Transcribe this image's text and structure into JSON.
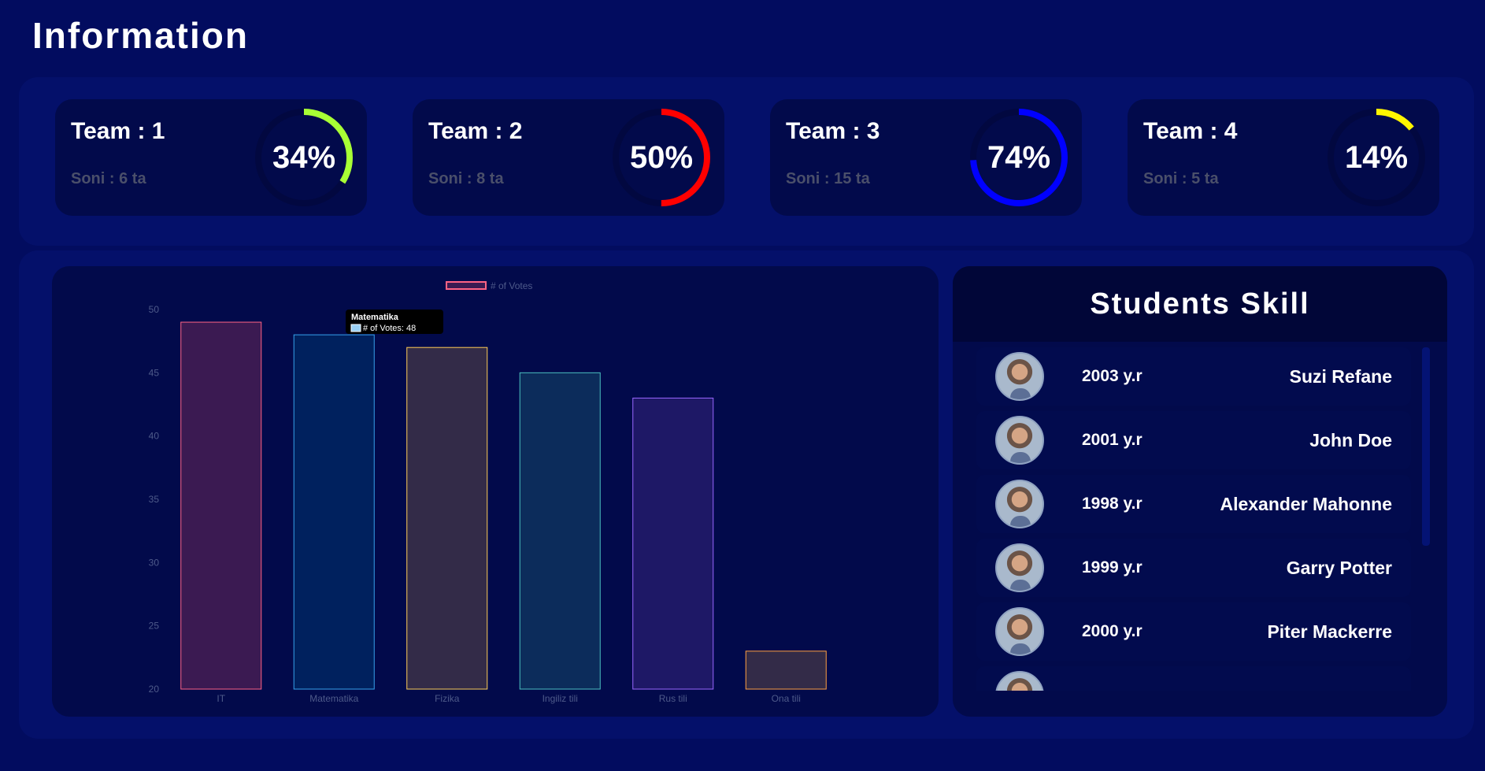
{
  "page": {
    "title": "Information"
  },
  "teams": [
    {
      "name": "Team : 1",
      "count": "Soni : 6 ta",
      "percent_label": "34%",
      "percent": 34,
      "color": "#a8ff35"
    },
    {
      "name": "Team : 2",
      "count": "Soni : 8 ta",
      "percent_label": "50%",
      "percent": 50,
      "color": "#ff0000"
    },
    {
      "name": "Team : 3",
      "count": "Soni : 15 ta",
      "percent_label": "74%",
      "percent": 74,
      "color": "#0000ff"
    },
    {
      "name": "Team : 4",
      "count": "Soni : 5 ta",
      "percent_label": "14%",
      "percent": 14,
      "color": "#fff500"
    }
  ],
  "skills": {
    "title": "Students Skill",
    "rows": [
      {
        "year": "2003 y.r",
        "name": "Suzi Refane",
        "avatar": "avatar-photo"
      },
      {
        "year": "2001 y.r",
        "name": "John Doe",
        "avatar": "avatar-photo"
      },
      {
        "year": "1998 y.r",
        "name": "Alexander Mahonne",
        "avatar": "avatar-photo"
      },
      {
        "year": "1999 y.r",
        "name": "Garry Potter",
        "avatar": "avatar-photo"
      },
      {
        "year": "2000 y.r",
        "name": "Piter Mackerre",
        "avatar": "avatar-photo"
      },
      {
        "year": "",
        "name": "",
        "avatar": "avatar-photo"
      }
    ]
  },
  "chart_data": {
    "type": "bar",
    "categories": [
      "IT",
      "Matematika",
      "Fizika",
      "Ingiliz tili",
      "Rus tili",
      "Ona tili"
    ],
    "series": [
      {
        "name": "# of Votes",
        "values": [
          49,
          48,
          47,
          45,
          43,
          23
        ]
      }
    ],
    "ylim": [
      20,
      50
    ],
    "yticks": [
      20,
      25,
      30,
      35,
      40,
      45,
      50
    ],
    "legend": "top-center",
    "bar_fill_colors": [
      "#3b1a52",
      "#00215e",
      "#332b48",
      "#0c2c5b",
      "#1e1866",
      "#332b48"
    ],
    "bar_border_colors": [
      "#ff6384",
      "#36a2eb",
      "#ffce56",
      "#4bc0c0",
      "#9966ff",
      "#ff9f40"
    ],
    "legend_swatch": {
      "fill": "#3b1a52",
      "border": "#ff6384"
    },
    "tooltip": {
      "title": "Matematika",
      "text": "# of Votes: 48",
      "swatch": "#9ad0f5"
    },
    "grid": false
  }
}
